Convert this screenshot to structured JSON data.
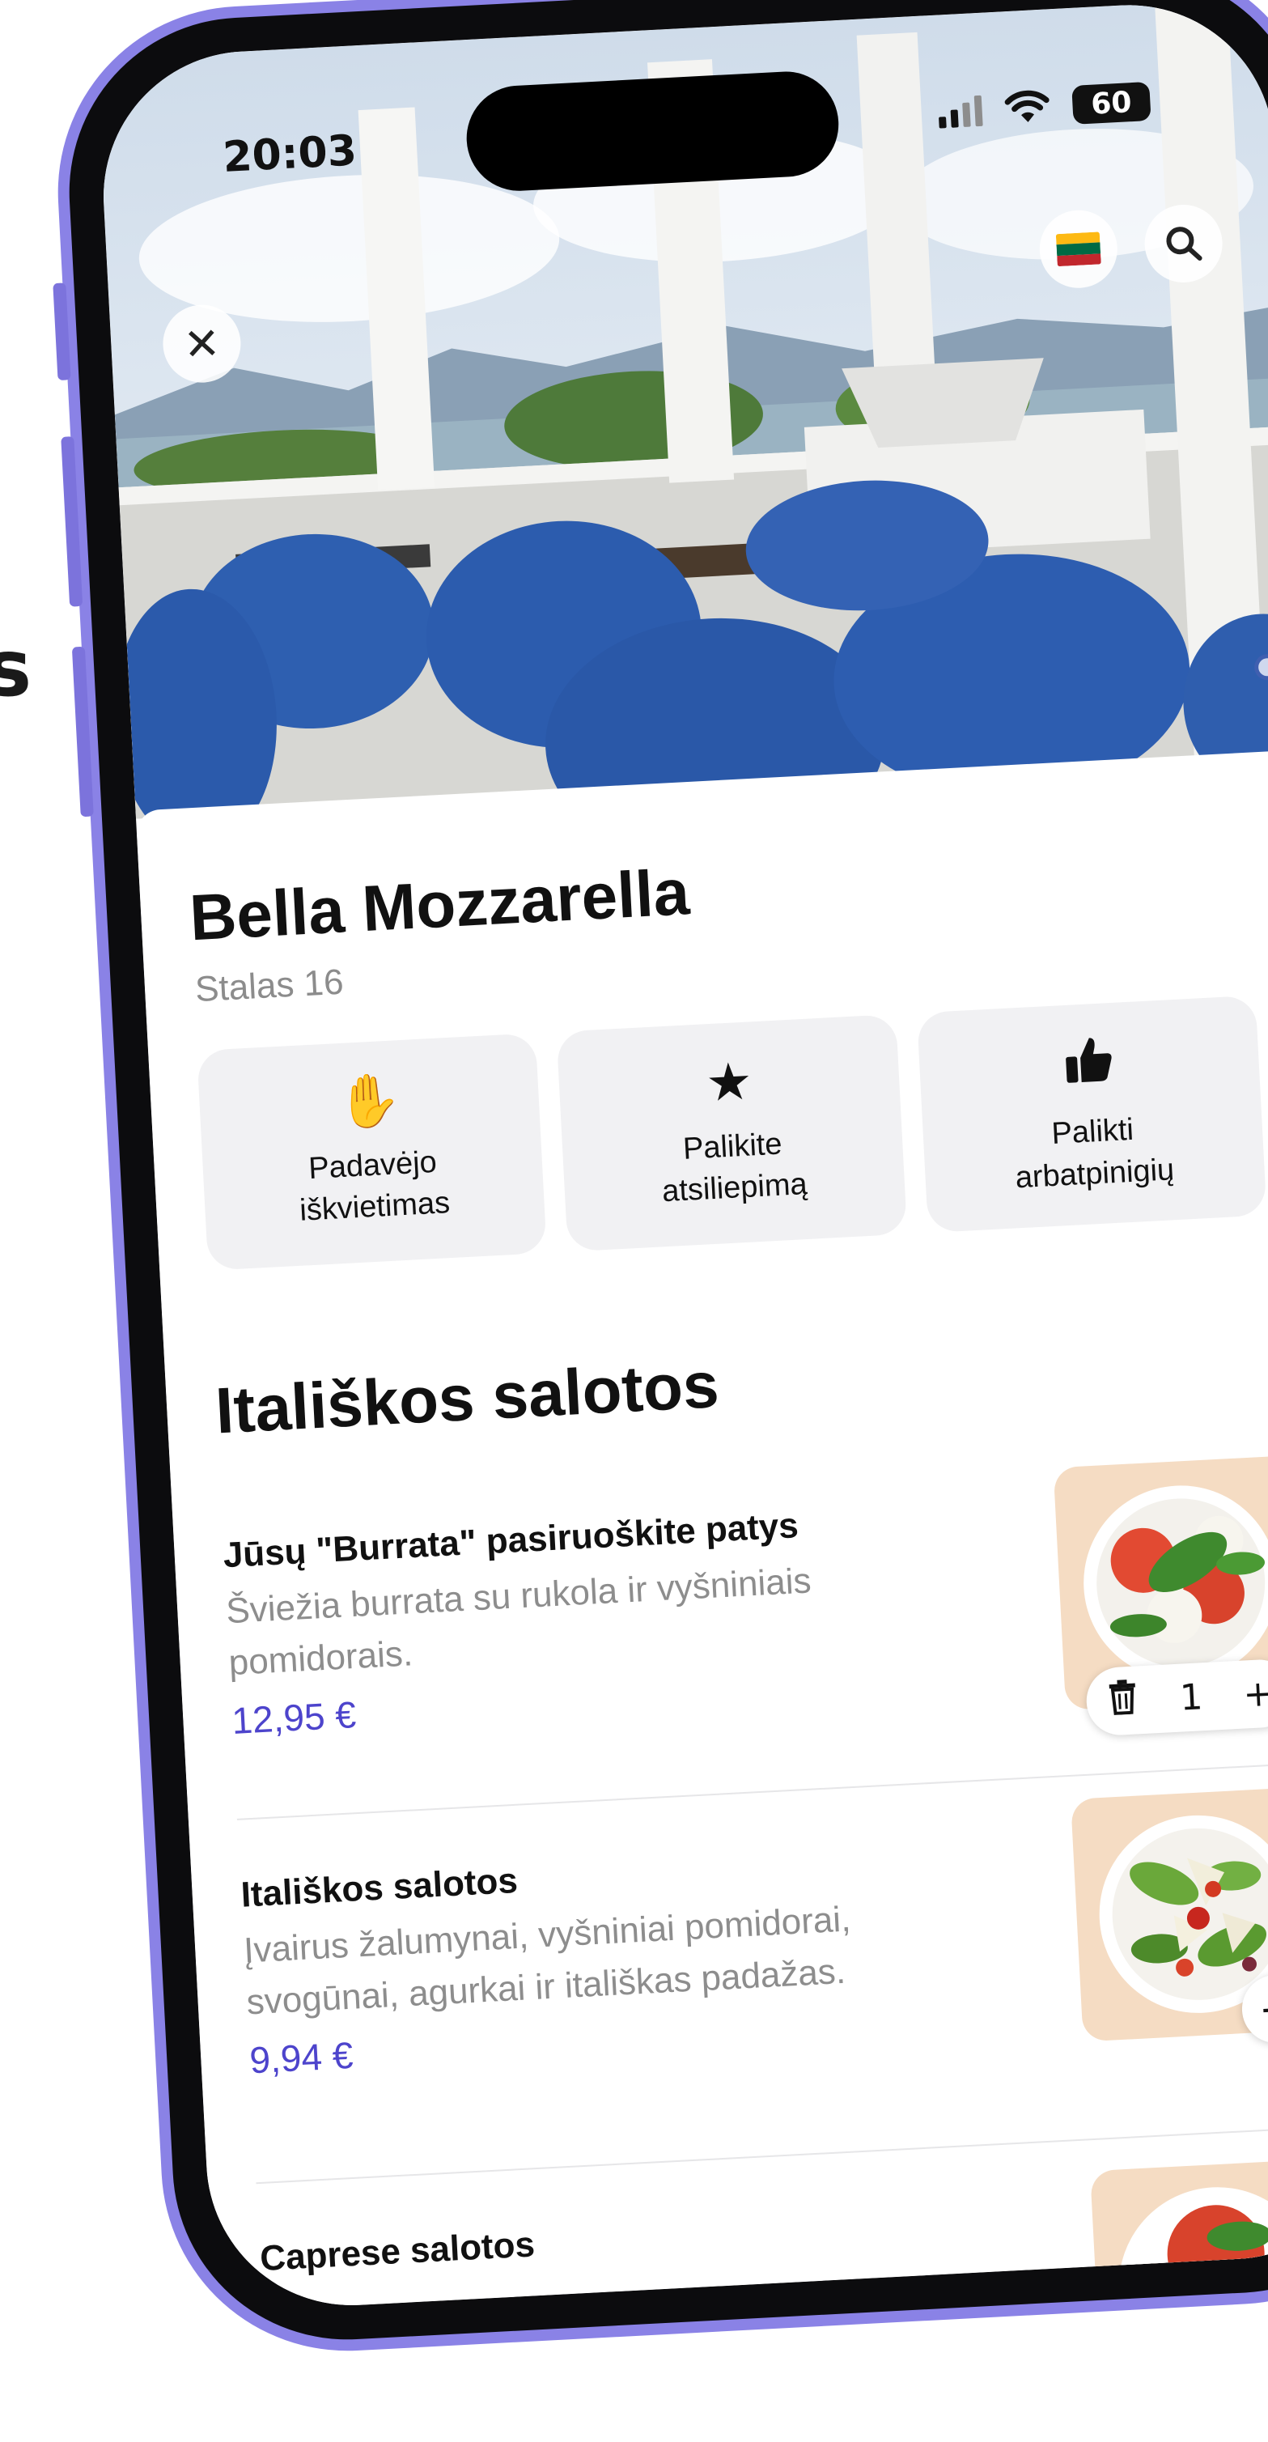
{
  "background_text": "s",
  "status_bar": {
    "time": "20:03",
    "battery": "60"
  },
  "header": {
    "close_icon": "close-icon",
    "language_icon": "lithuania-flag-icon",
    "search_icon": "search-icon",
    "flag_colors": [
      "#FDB913",
      "#006A44",
      "#C1272D"
    ]
  },
  "restaurant": {
    "name": "Bella Mozzarella",
    "table": "Stalas 16"
  },
  "actions": [
    {
      "icon": "raised-hand-icon",
      "label": "Padavėjo iškvietimas"
    },
    {
      "icon": "star-icon",
      "label": "Palikite atsiliepimą"
    },
    {
      "icon": "thumbs-up-icon",
      "label": "Palikti arbatpinigių"
    }
  ],
  "section": {
    "title": "Itališkos salotos"
  },
  "menu_items": [
    {
      "name": "Jūsų \"Burrata\" pasiruoškite patys",
      "description": "Šviežia burrata su rukola ir vyšniniais pomidorais.",
      "price": "12,95 €",
      "quantity": "1"
    },
    {
      "name": "Itališkos salotos",
      "description": "Įvairus žalumynai, vyšniniai pomidorai, svogūnai, agurkai ir itališkas padažas.",
      "price": "9,94 €",
      "add_label": "+"
    },
    {
      "name": "Caprese salotos"
    }
  ],
  "colors": {
    "accent": "#4d44cc",
    "frame": "#8a82e6"
  }
}
